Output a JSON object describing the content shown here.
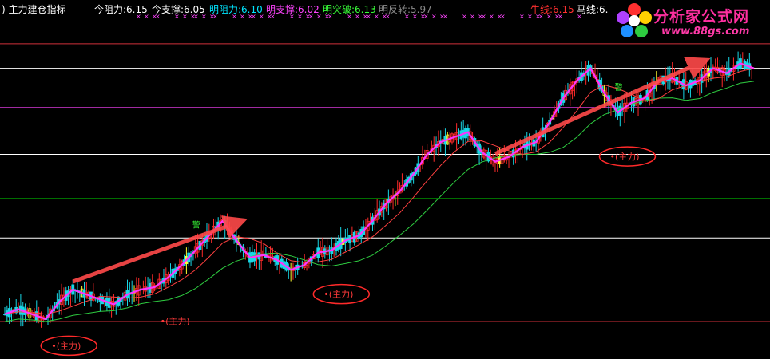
{
  "header": {
    "title": ") 主力建仓指标",
    "stats": [
      {
        "label": "今阻力:",
        "value": "6.15",
        "color": "#ffffff"
      },
      {
        "label": "今支撑:",
        "value": "6.05",
        "color": "#ffffff"
      },
      {
        "label": "明阻力:",
        "value": "6.10",
        "color": "#00e5ff"
      },
      {
        "label": "明支撑:",
        "value": "6.02",
        "color": "#ff44ff"
      },
      {
        "label": "明突破:",
        "value": "6.13",
        "color": "#39ff39"
      },
      {
        "label": "明反转:",
        "value": "5.97",
        "color": "#8a8a8a"
      },
      {
        "label": "牛线:",
        "value": "6.15",
        "color": "#ff3030"
      },
      {
        "label": "马线:",
        "value": "6.",
        "color": "#ffffff"
      }
    ]
  },
  "logo": {
    "title": "分析家公式网",
    "url": "www.88gs.com"
  },
  "annotations": {
    "main_force_label": "•(主力)",
    "signal_label": "警"
  },
  "colors": {
    "background": "#000000",
    "up": "#ff2a2a",
    "down": "#18d7e6",
    "fast_line": "#ff33ff",
    "ma_red": "#ff4040",
    "ma_green": "#2ecc40",
    "arrow": "#ff4a4a",
    "cross_marks": "#ff44ff"
  },
  "chart_data": {
    "type": "candlestick",
    "title": "主力建仓指标",
    "trend": [
      5.1,
      5.12,
      5.1,
      5.08,
      5.15,
      5.2,
      5.18,
      5.16,
      5.14,
      5.18,
      5.2,
      5.21,
      5.25,
      5.3,
      5.36,
      5.42,
      5.48,
      5.4,
      5.33,
      5.34,
      5.32,
      5.28,
      5.3,
      5.35,
      5.36,
      5.4,
      5.42,
      5.48,
      5.55,
      5.6,
      5.67,
      5.75,
      5.8,
      5.82,
      5.84,
      5.76,
      5.72,
      5.74,
      5.78,
      5.8,
      5.88,
      5.98,
      6.05,
      6.1,
      6.0,
      5.92,
      5.96,
      5.98,
      6.05,
      6.06,
      6.03,
      6.05,
      6.1,
      6.08,
      6.12,
      6.1
    ],
    "horizontal_levels": [
      {
        "value": 6.2,
        "color": "#d0303a"
      },
      {
        "value": 6.1,
        "color": "#ffffff"
      },
      {
        "value": 5.94,
        "color": "#ff44ff"
      },
      {
        "value": 5.75,
        "color": "#ffffff"
      },
      {
        "value": 5.57,
        "color": "#00dd00"
      },
      {
        "value": 5.41,
        "color": "#ffffff"
      },
      {
        "value": 5.07,
        "color": "#d0303a"
      }
    ],
    "main_force_positions": [
      4,
      12,
      24,
      45
    ],
    "arrows": [
      {
        "from": 5,
        "to": 17
      },
      {
        "from": 36,
        "to": 51
      }
    ]
  }
}
